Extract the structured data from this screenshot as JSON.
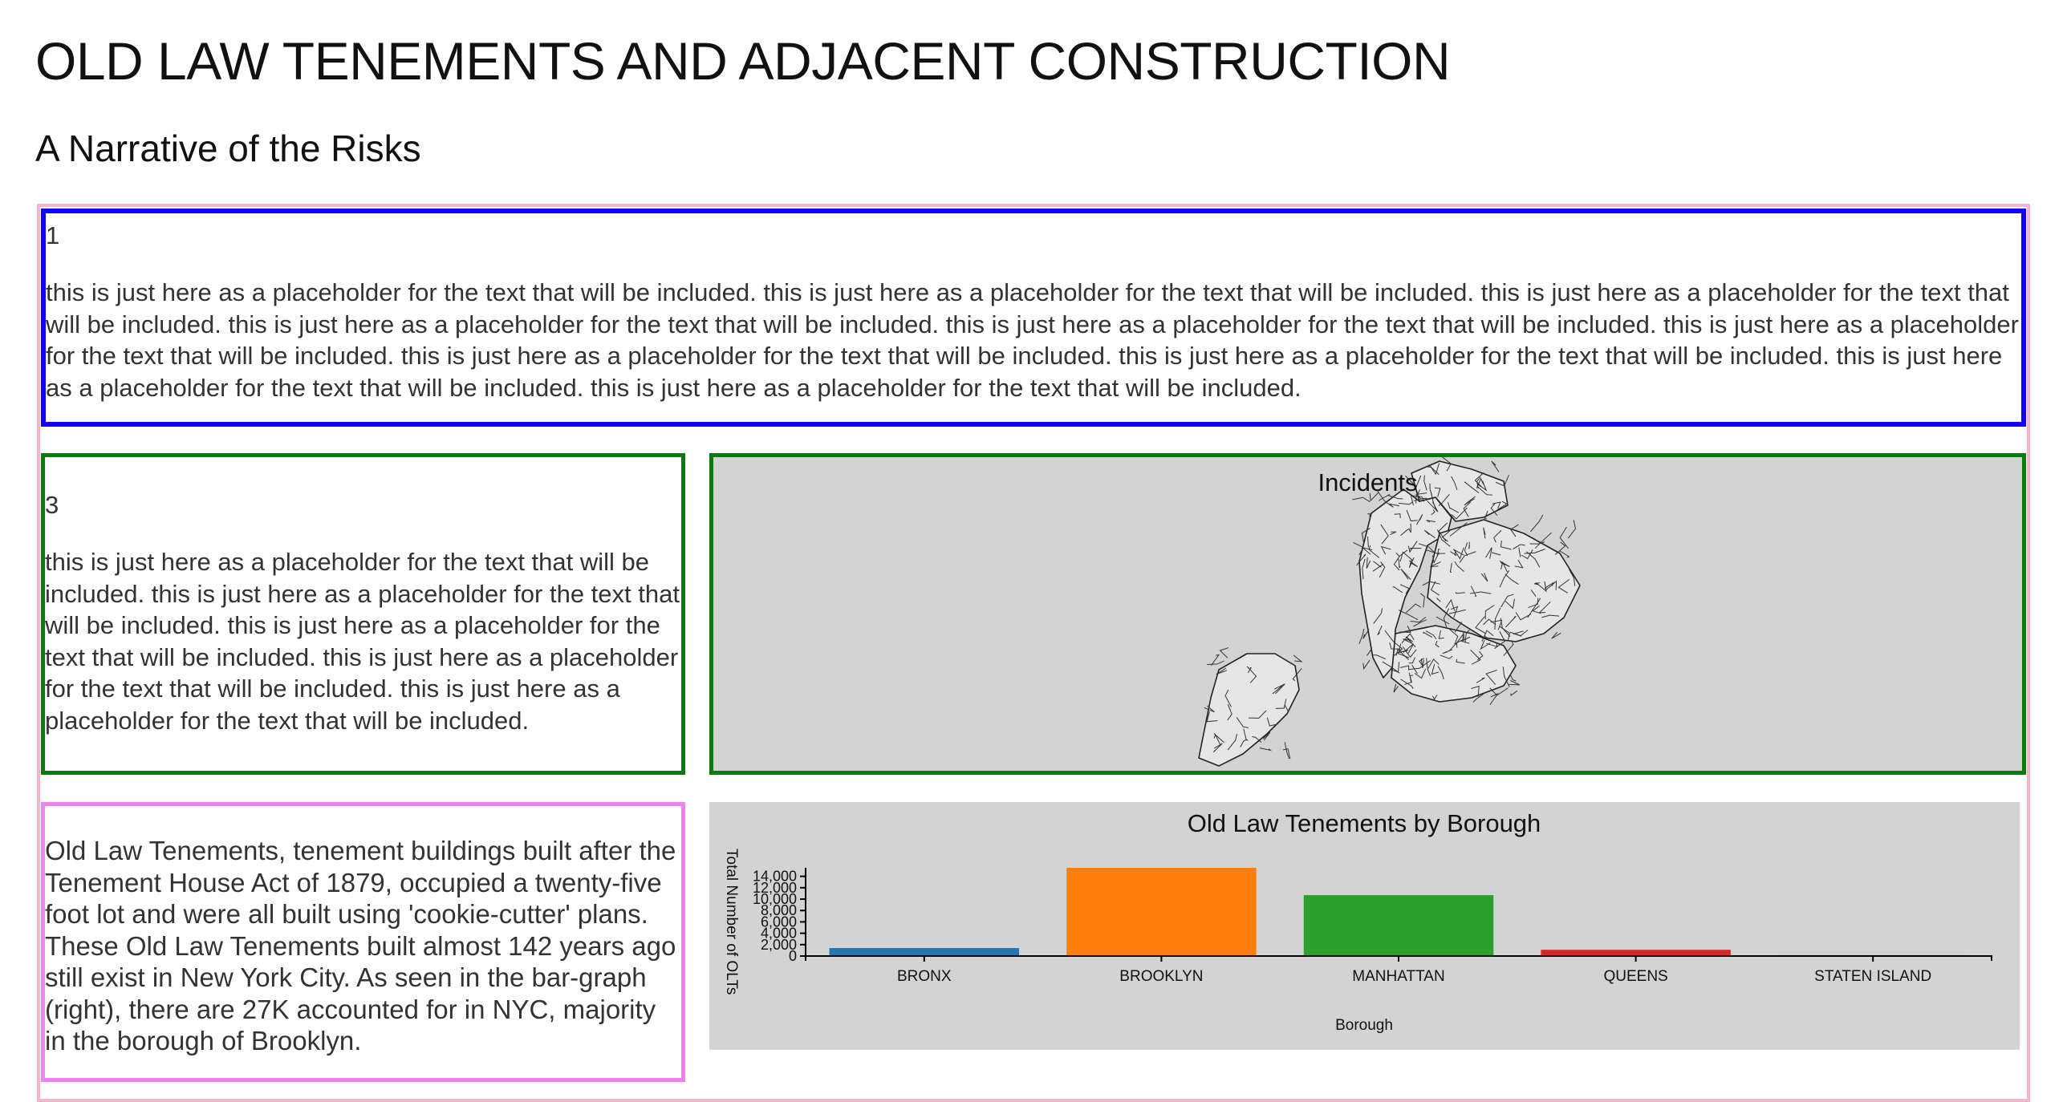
{
  "header": {
    "title": "OLD LAW TENEMENTS AND ADJACENT CONSTRUCTION",
    "subtitle": "A Narrative of the Risks"
  },
  "colors": {
    "panel1_border": "#1400ff",
    "panel3_border": "#0b7a0b",
    "map_border": "#0b7a0b",
    "olt_border": "#ee82ee",
    "outer_border": "#f7b6cf",
    "chart_bg": "#d3d3d3"
  },
  "panels": {
    "p1": {
      "number": "1",
      "text": "this is just here as a placeholder for the text that will be included. this is just here as a placeholder for the text that will be included. this is just here as a placeholder for the text that will be included. this is just here as a placeholder for the text that will be included. this is just here as a placeholder for the text that will be included. this is just here as a placeholder for the text that will be included. this is just here as a placeholder for the text that will be included. this is just here as a placeholder for the text that will be included. this is just here as a placeholder for the text that will be included. this is just here as a placeholder for the text that will be included."
    },
    "p3": {
      "number": "3",
      "text": "this is just here as a placeholder for the text that will be included. this is just here as a placeholder for the text that will be included. this is just here as a placeholder for the text that will be included. this is just here as a placeholder for the text that will be included. this is just here as a placeholder for the text that will be included."
    },
    "olt": {
      "text": "Old Law Tenements, tenement buildings built after the Tenement House Act of 1879, occupied a twenty-five foot lot and were all built using 'cookie-cutter' plans. These Old Law Tenements built almost 142 years ago still exist in New York City. As seen in the bar-graph (right), there are 27K accounted for in NYC, majority in the borough of Brooklyn."
    }
  },
  "map": {
    "title": "Incidents"
  },
  "chart_data": {
    "type": "bar",
    "title": "Old Law Tenements by Borough",
    "xlabel": "Borough",
    "ylabel": "Total Number of OLTs",
    "categories": [
      "BRONX",
      "BROOKLYN",
      "MANHATTAN",
      "QUEENS",
      "STATEN ISLAND"
    ],
    "values": [
      1400,
      15500,
      10700,
      1100,
      150
    ],
    "colors": [
      "#1f77b4",
      "#ff7f0e",
      "#2ca02c",
      "#d62728",
      "#9467bd"
    ],
    "ylim": [
      0,
      15500
    ],
    "yticks": [
      "0",
      "2,000",
      "4,000",
      "6,000",
      "8,000",
      "10,000",
      "12,000",
      "14,000"
    ],
    "grid": false,
    "legend": "none"
  }
}
